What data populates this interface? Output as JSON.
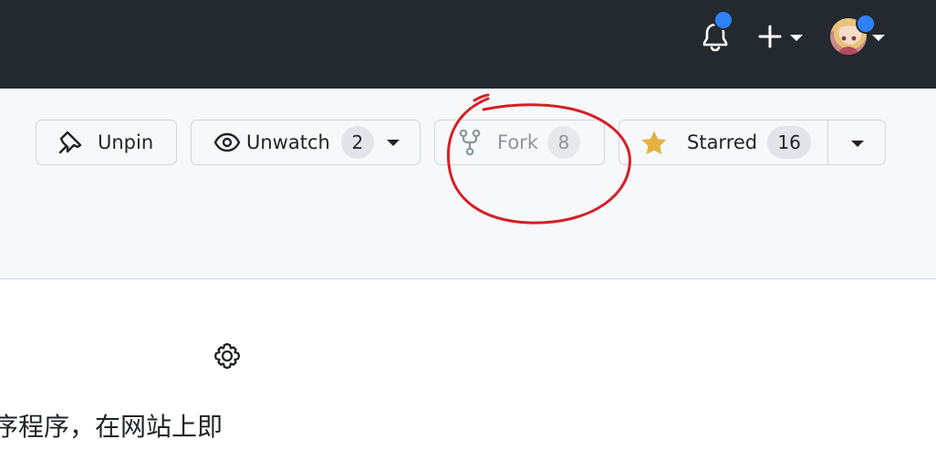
{
  "header": {
    "icons": [
      "bell-icon",
      "plus-icon",
      "avatar"
    ],
    "notification_color": "#2f81f7"
  },
  "repo_actions": {
    "unpin": {
      "label": "Unpin",
      "icon": "pin-icon"
    },
    "unwatch": {
      "label": "Unwatch",
      "count": "2",
      "icon": "eye-icon"
    },
    "fork": {
      "label": "Fork",
      "count": "8",
      "icon": "repo-forked-icon",
      "disabled": true
    },
    "star": {
      "label": "Starred",
      "count": "16",
      "icon": "star-fill-icon",
      "color": "#e3b341"
    }
  },
  "annotation": {
    "type": "red-circle",
    "target": "fork-button",
    "color": "#d42027"
  },
  "about": {
    "description_fragment": "序程序，在网站上即",
    "settings_icon": "gear-icon"
  }
}
